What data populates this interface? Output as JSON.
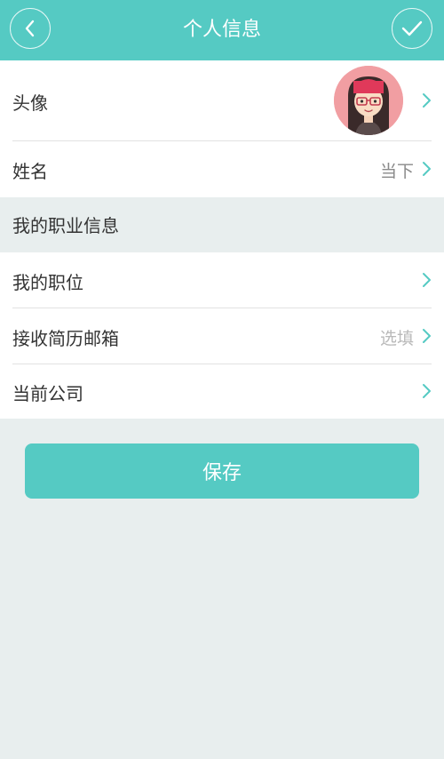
{
  "header": {
    "title": "个人信息",
    "back_icon": "chevron-left-icon",
    "confirm_icon": "checkmark-icon"
  },
  "profile": {
    "avatar_label": "头像",
    "name_label": "姓名",
    "name_value": "当下"
  },
  "section": {
    "title": "我的职业信息"
  },
  "career": {
    "position_label": "我的职位",
    "email_label": "接收简历邮箱",
    "email_placeholder": "选填",
    "company_label": "当前公司"
  },
  "actions": {
    "save_label": "保存"
  },
  "colors": {
    "accent": "#55cac3",
    "background": "#e8eeee",
    "chevron": "#55cac3"
  }
}
